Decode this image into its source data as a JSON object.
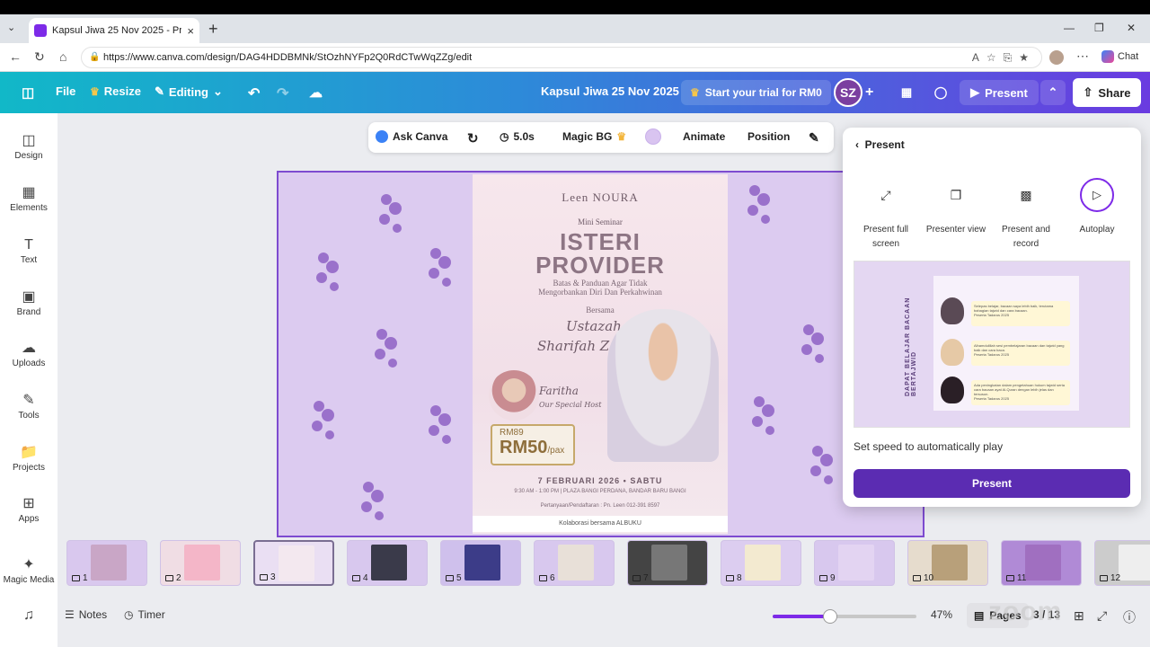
{
  "browser": {
    "tab_title": "Kapsul Jiwa 25 Nov 2025 - Present",
    "url": "https://www.canva.com/design/DAG4HDDBMNk/StOzhNYFp2Q0RdCTwWqZZg/edit",
    "chat_label": "Chat"
  },
  "header": {
    "file": "File",
    "resize": "Resize",
    "editing": "Editing",
    "title": "Kapsul Jiwa 25 Nov 2025",
    "trial": "Start your trial for RM0",
    "avatar_initials": "SZ",
    "present": "Present",
    "share": "Share"
  },
  "sidebar": {
    "items": [
      {
        "label": "Design",
        "icon": "design-icon"
      },
      {
        "label": "Elements",
        "icon": "elements-icon"
      },
      {
        "label": "Text",
        "icon": "text-icon"
      },
      {
        "label": "Brand",
        "icon": "brand-icon"
      },
      {
        "label": "Uploads",
        "icon": "uploads-icon"
      },
      {
        "label": "Tools",
        "icon": "tools-icon"
      },
      {
        "label": "Projects",
        "icon": "projects-icon"
      },
      {
        "label": "Apps",
        "icon": "apps-icon"
      },
      {
        "label": "Magic Media",
        "icon": "magic-media-icon"
      }
    ]
  },
  "toolbar": {
    "ask_canva": "Ask Canva",
    "duration": "5.0s",
    "magic_bg": "Magic BG",
    "animate": "Animate",
    "position": "Position"
  },
  "poster": {
    "brand": "Leen NOURA",
    "mini": "Mini Seminar",
    "line1": "ISTERI",
    "line2": "PROVIDER",
    "tagline1": "Batas & Panduan Agar Tidak",
    "tagline2": "Mengorbankan Diri Dan Perkahwinan",
    "bersama": "Bersama",
    "speaker1": "Ustazah",
    "speaker2": "Sharifah Zahidah",
    "host_name": "Faritha",
    "host_role": "Our Special Host",
    "price_old": "RM89",
    "price_new": "RM50",
    "price_unit": "/pax",
    "date": "7 FEBRUARI 2026 • SABTU",
    "venue": "9:30 AM - 1:00 PM | PLAZA BANGI PERDANA, BANDAR BARU BANGI",
    "contact": "Pertanyaan/Pendaftaran : Pn. Leen 012-391 8597",
    "collab": "Kolaborasi bersama ALBUKU"
  },
  "present_panel": {
    "title": "Present",
    "options": [
      {
        "label": "Present full screen"
      },
      {
        "label": "Presenter view"
      },
      {
        "label": "Present and record"
      },
      {
        "label": "Autoplay"
      }
    ],
    "preview_title": "DAPAT BELAJAR BACAAN BERTAJWID",
    "testimonials": [
      {
        "text": "Selepas belajar, bacaan saya lebih baik, terutama bahagian tajwid dan cara bacaan.",
        "who": "Peserta Tadarus 2025"
      },
      {
        "text": "Alhamdulillah sesi pembelajaran bacaan dan tajwid yang baik dan cara baca.",
        "who": "Peserta Tadarus 2025"
      },
      {
        "text": "Ada peningkatan dalam pengetahuan hukum tajwid serta cara bacaan ayat Al-Quran dengan lebih jelas dan tersusun.",
        "who": "Peserta Tadarus 2025"
      }
    ],
    "speed_text": "Set speed to automatically play",
    "present_button": "Present"
  },
  "thumbnails": {
    "numbers": [
      "1",
      "2",
      "3",
      "4",
      "5",
      "6",
      "7",
      "8",
      "9",
      "10",
      "11",
      "12"
    ],
    "active_index": 3
  },
  "bottom": {
    "notes": "Notes",
    "timer": "Timer",
    "zoom": "47%",
    "zoom_level": 0.47,
    "pages": "Pages",
    "page_count": "3 / 13"
  },
  "watermark": "zoom",
  "colors": {
    "brand_purple": "#7d2ae8",
    "present_button": "#5b2cb2",
    "canvas_bg": "#dccbf0"
  }
}
